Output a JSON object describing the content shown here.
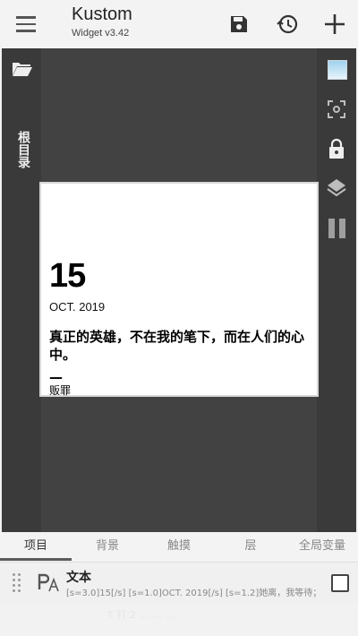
{
  "header": {
    "title": "Kustom",
    "version": "Widget v3.42",
    "icons": [
      "menu-icon",
      "save-icon",
      "history-icon",
      "add-icon"
    ]
  },
  "left_rail": {
    "label": "根目录",
    "icon": "folder-open-icon"
  },
  "right_rail": {
    "icons": [
      "wallpaper-preview-icon",
      "focus-icon",
      "lock-icon",
      "layers-icon",
      "pause-icon"
    ]
  },
  "widget": {
    "day": "15",
    "month_year": "OCT.  2019",
    "quote": "真正的英雄，不在我的笔下，而在人们的心中。",
    "dash": "—",
    "author": "贩罪"
  },
  "tabs": [
    "项目",
    "背景",
    "触摸",
    "层",
    "全局变量"
  ],
  "item": {
    "title": "文本",
    "subtitle": "[s=3.0]15[/s] [s=1.0]OCT.  2019[/s]  [s=1.2]她离，我等待；…",
    "ghost_text": "T 钉 2 … … …",
    "icon": "text-format-icon"
  },
  "colors": {
    "stage": "#424242",
    "rail": "#3a3a3a",
    "widget_bg": "#ffffff"
  }
}
